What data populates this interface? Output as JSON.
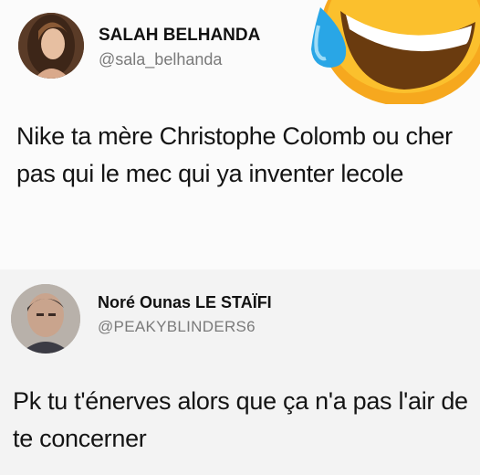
{
  "tweets": [
    {
      "name": "SALAH BELHANDA",
      "handle": "@sala_belhanda",
      "text": "Nike ta mère Christophe Colomb ou cher pas qui le mec qui ya inventer lecole"
    },
    {
      "name": "Noré Ounas LE STAÏFI",
      "handle": "@PEAKYBLINDERS6",
      "text": "Pk tu t'énerves alors que ça n'a pas l'air de te concerner"
    }
  ],
  "emoji": "face-with-tears-of-joy-icon"
}
